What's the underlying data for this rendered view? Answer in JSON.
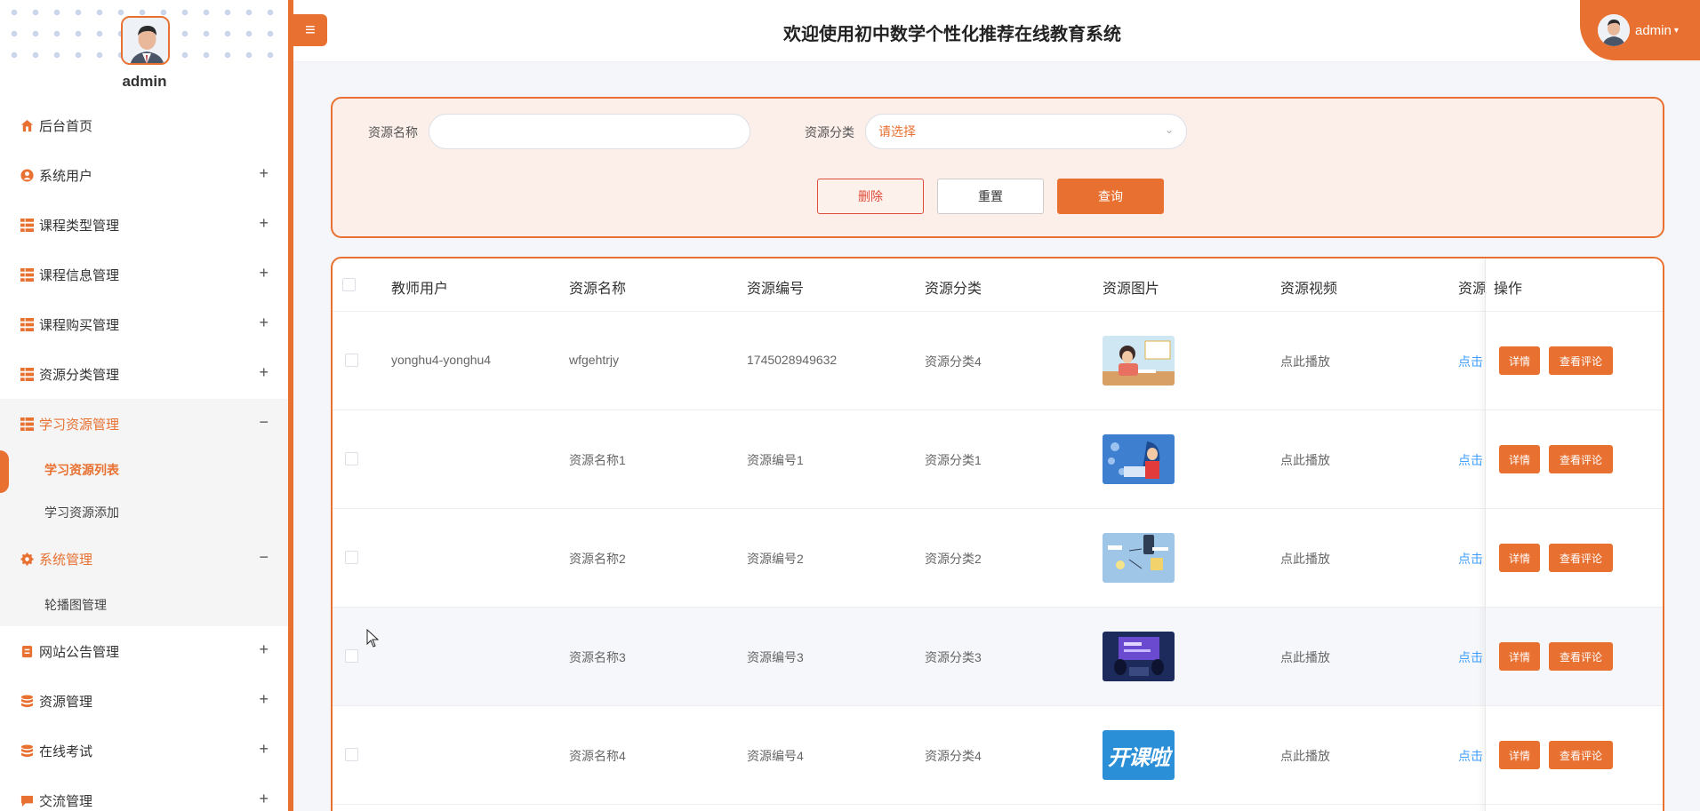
{
  "sidebar": {
    "username": "admin",
    "items": [
      {
        "label": "后台首页",
        "icon": "home-icon"
      },
      {
        "label": "系统用户",
        "icon": "user-icon"
      },
      {
        "label": "课程类型管理",
        "icon": "grid-icon"
      },
      {
        "label": "课程信息管理",
        "icon": "grid-icon"
      },
      {
        "label": "课程购买管理",
        "icon": "grid-icon"
      },
      {
        "label": "资源分类管理",
        "icon": "grid-icon"
      },
      {
        "label": "学习资源管理",
        "icon": "grid-icon",
        "sub": [
          "学习资源列表",
          "学习资源添加"
        ]
      },
      {
        "label": "系统管理",
        "icon": "gear-icon",
        "sub": [
          "轮播图管理"
        ]
      },
      {
        "label": "网站公告管理",
        "icon": "notice-icon"
      },
      {
        "label": "资源管理",
        "icon": "database-icon"
      },
      {
        "label": "在线考试",
        "icon": "database-icon"
      },
      {
        "label": "交流管理",
        "icon": "chat-icon"
      }
    ]
  },
  "header": {
    "menu_toggle": "≡",
    "title": "欢迎使用初中数学个性化推荐在线教育系统",
    "user": "admin"
  },
  "search": {
    "name_label": "资源名称",
    "name_value": "",
    "category_label": "资源分类",
    "category_placeholder": "请选择",
    "delete_label": "删除",
    "reset_label": "重置",
    "query_label": "查询"
  },
  "table": {
    "headers": [
      "教师用户",
      "资源名称",
      "资源编号",
      "资源分类",
      "资源图片",
      "资源视频",
      "资源",
      "操作"
    ],
    "rows": [
      {
        "teacher": "yonghu4-yonghu4",
        "name": "wfgehtrjy",
        "code": "1745028949632",
        "category": "资源分类4",
        "video": "点此播放",
        "file": "点击",
        "image": "study-girl"
      },
      {
        "teacher": "",
        "name": "资源名称1",
        "code": "资源编号1",
        "category": "资源分类1",
        "video": "点此播放",
        "file": "点击",
        "image": "laptop-woman"
      },
      {
        "teacher": "",
        "name": "资源名称2",
        "code": "资源编号2",
        "category": "资源分类2",
        "video": "点此播放",
        "file": "点击",
        "image": "mindmap"
      },
      {
        "teacher": "",
        "name": "资源名称3",
        "code": "资源编号3",
        "category": "资源分类3",
        "video": "点此播放",
        "file": "点击",
        "image": "online-class"
      },
      {
        "teacher": "",
        "name": "资源名称4",
        "code": "资源编号4",
        "category": "资源分类4",
        "video": "点此播放",
        "file": "点击",
        "image": "kaikela-banner",
        "image_text": "开课啦"
      }
    ],
    "detail_label": "详情",
    "comment_label": "查看评论"
  },
  "colors": {
    "accent": "#e87132",
    "link": "#409eff"
  }
}
